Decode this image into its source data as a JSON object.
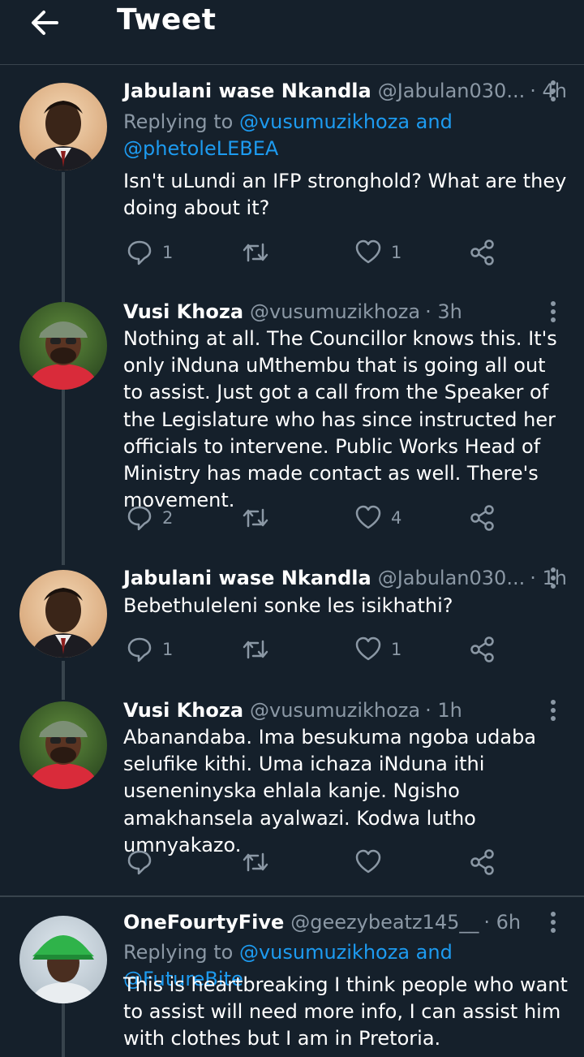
{
  "header": {
    "title": "Tweet",
    "back_icon": "arrow-left-icon"
  },
  "colors": {
    "background": "#15202b",
    "text": "#ffffff",
    "muted": "#8b98a5",
    "link": "#1d9bf0",
    "divider": "#38444d"
  },
  "tweets": [
    {
      "name": "Jabulani wase Nkandla",
      "handle": "@Jabulan030...",
      "time": "· 4h",
      "reply_prefix": "Replying to ",
      "reply_mentions_line1": "@vusumuzikhoza and",
      "reply_mentions_line2": "@phetoleLEBEA",
      "text": "Isn't uLundi an IFP stronghold? What are they doing about it?",
      "replies": "1",
      "retweets": "",
      "likes": "1"
    },
    {
      "name": "Vusi Khoza",
      "handle": "@vusumuzikhoza",
      "time": "· 3h",
      "text": "Nothing at all. The Councillor knows this. It's only iNduna uMthembu that is going all out to assist. Just got a call from the Speaker of the Legislature who has since instructed her officials to intervene. Public Works Head of Ministry has made contact as well. There's movement.",
      "replies": "2",
      "retweets": "",
      "likes": "4"
    },
    {
      "name": "Jabulani wase Nkandla",
      "handle": "@Jabulan030...",
      "time": "· 1h",
      "text": "Bebethuleleni sonke les isikhathi?",
      "replies": "1",
      "retweets": "",
      "likes": "1"
    },
    {
      "name": "Vusi Khoza",
      "handle": "@vusumuzikhoza",
      "time": "· 1h",
      "text": "Abanandaba. Ima besukuma ngoba udaba selufike kithi. Uma ichaza iNduna ithi useneninyska ehlala kanje. Ngisho amakhansela ayalwazi. Kodwa lutho umnyakazo.",
      "replies": "",
      "retweets": "",
      "likes": ""
    },
    {
      "name": "OneFourtyFive",
      "handle": "@geezybeatz145__",
      "time": "· 6h",
      "reply_prefix": "Replying to ",
      "reply_mentions_line1": "@vusumuzikhoza and @FutureBite",
      "text": "This is heartbreaking I think people who want to assist will need more info, I can assist him with clothes but I am in Pretoria."
    }
  ],
  "icons": {
    "reply": "reply-icon",
    "retweet": "retweet-icon",
    "like": "heart-icon",
    "share": "share-icon",
    "more": "more-options-icon"
  }
}
